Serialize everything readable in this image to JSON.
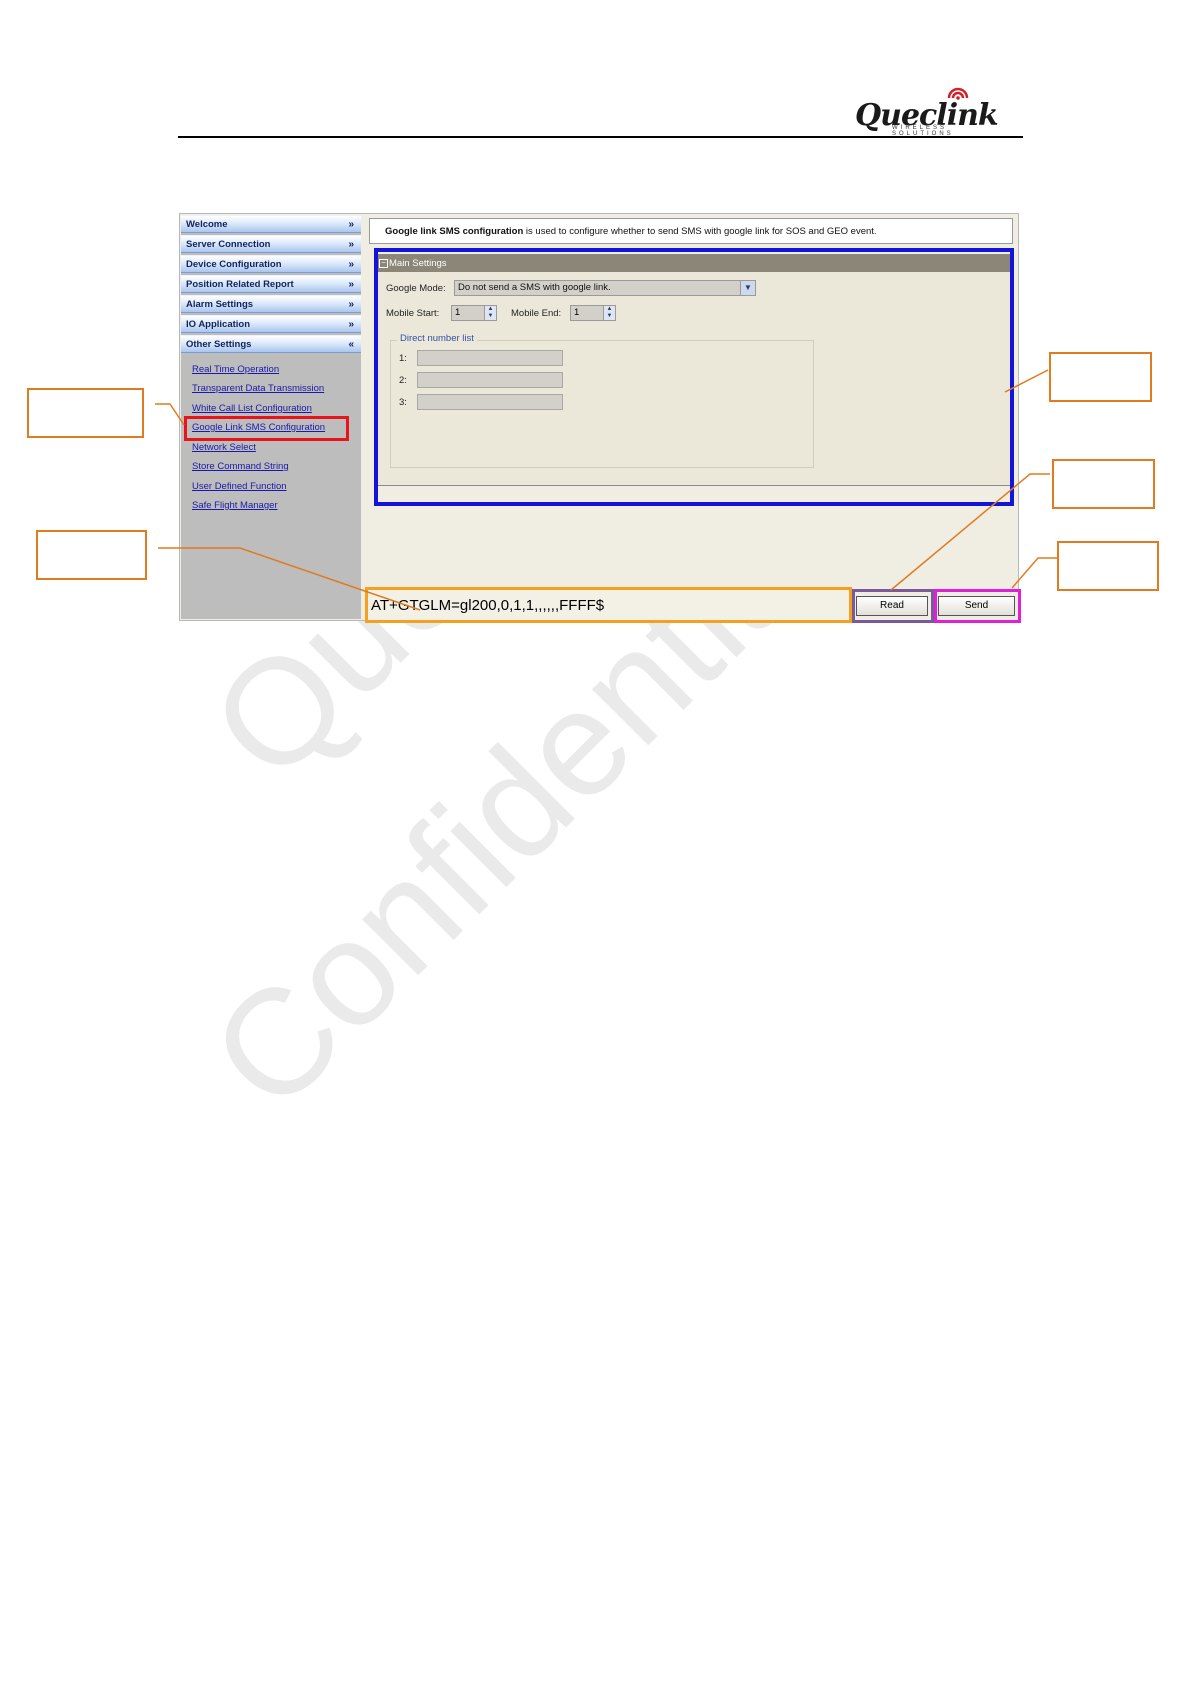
{
  "header": {
    "logo_text": "Queclink",
    "logo_sub": "WIRELESS SOLUTIONS"
  },
  "sidebar": {
    "sections": [
      {
        "label": "Welcome",
        "chevron": "»"
      },
      {
        "label": "Server Connection",
        "chevron": "»"
      },
      {
        "label": "Device Configuration",
        "chevron": "»"
      },
      {
        "label": "Position Related Report",
        "chevron": "»"
      },
      {
        "label": "Alarm Settings",
        "chevron": "»"
      },
      {
        "label": "IO Application",
        "chevron": "»"
      },
      {
        "label": "Other Settings",
        "chevron": "«"
      }
    ],
    "links": [
      "Real Time Operation",
      "Transparent Data Transmission",
      "White Call List Configuration",
      "Google Link SMS Configuration",
      "Network Select",
      "Store Command String",
      "User Defined Function",
      "Safe Flight Manager"
    ]
  },
  "main": {
    "description_bold": "Google link SMS configuration",
    "description_rest": " is used to configure whether to send SMS with google link for SOS and GEO event.",
    "settings_title": "Main Settings",
    "google_mode_label": "Google Mode:",
    "google_mode_value": "Do not send a SMS with google link.",
    "mobile_start_label": "Mobile Start:",
    "mobile_start_value": "1",
    "mobile_end_label": "Mobile End:",
    "mobile_end_value": "1",
    "direct_number_list_label": "Direct number list",
    "number_labels": [
      "1:",
      "2:",
      "3:"
    ]
  },
  "bottom": {
    "command": "AT+GTGLM=gl200,0,1,1,,,,,,FFFF$",
    "read_label": "Read",
    "send_label": "Send"
  },
  "watermark": {
    "line1": "Queclink",
    "line2": "Confidential"
  },
  "colors": {
    "highlight_red": "#e8141c",
    "highlight_blue": "#1414d8",
    "highlight_orange": "#f5a020",
    "highlight_purple": "#7a5a9a",
    "highlight_magenta": "#e020d8",
    "callout_orange": "#e07b1f"
  }
}
